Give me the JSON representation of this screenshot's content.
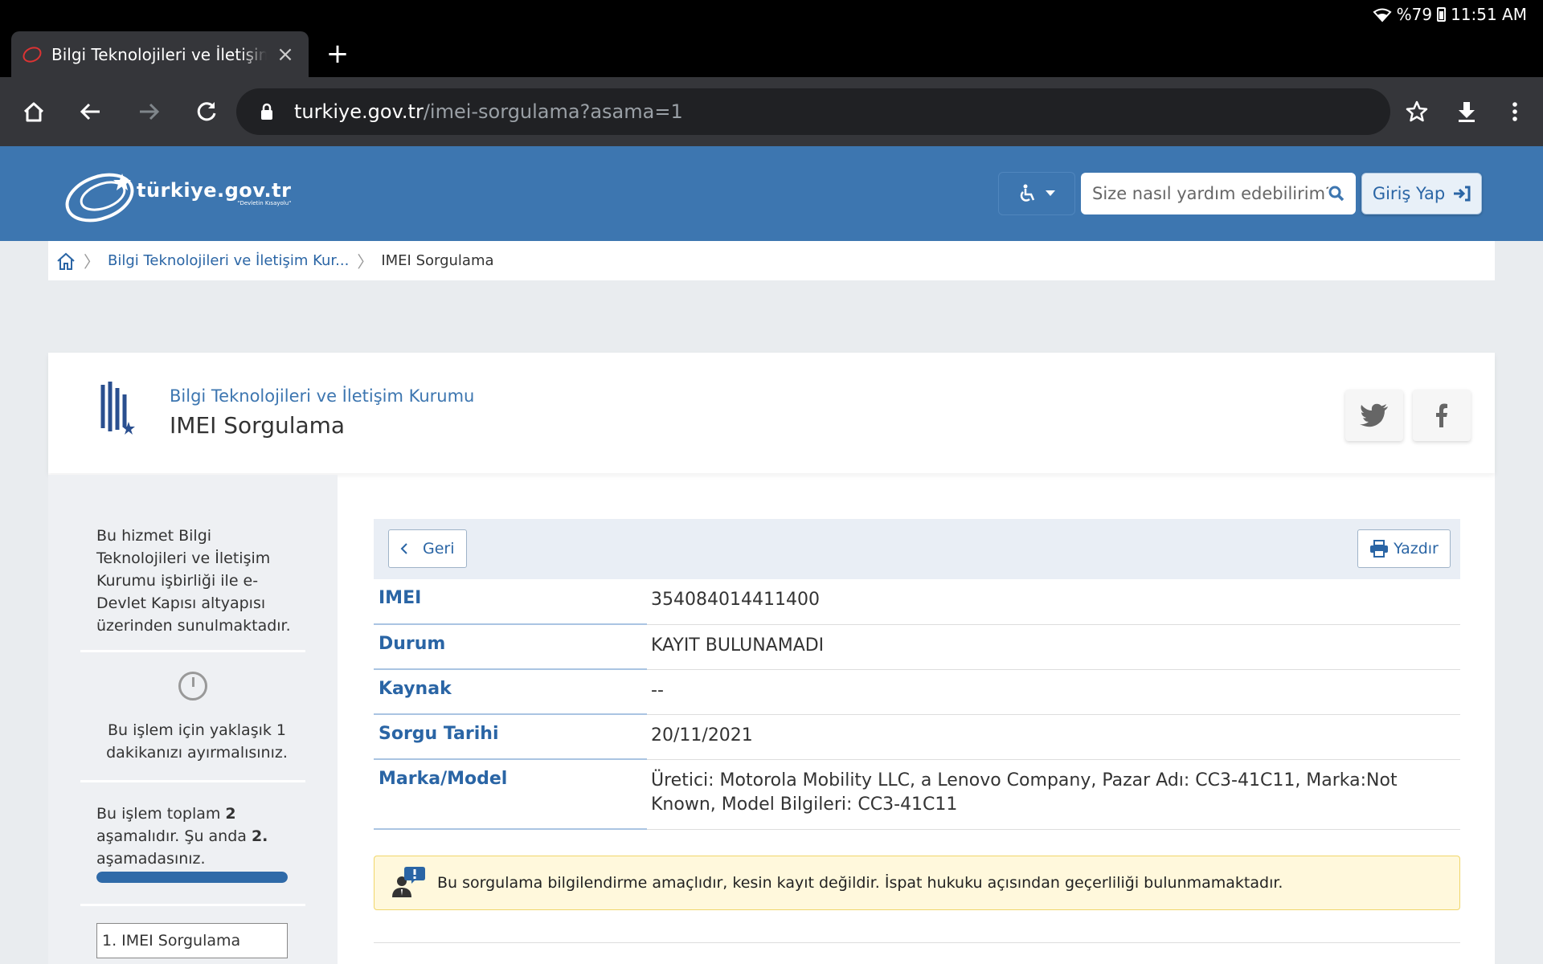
{
  "status_bar": {
    "battery": "%79",
    "time": "11:51 AM"
  },
  "browser": {
    "tab_title": "Bilgi Teknolojileri ve İletişim Kurumu",
    "new_tab_label": "+",
    "close_label": "×",
    "url_domain": "turkiye.gov.tr",
    "url_path": "/imei-sorgulama?asama=1"
  },
  "header": {
    "brand": "türkiye.gov.tr",
    "tagline": "\"Devletin Kısayolu\"",
    "search_placeholder": "Size nasıl yardım edebilirim?",
    "login_label": "Giriş Yap"
  },
  "breadcrumb": {
    "items": [
      "Bilgi Teknolojileri ve İletişim Kur...",
      "IMEI Sorgulama"
    ]
  },
  "service": {
    "institution": "Bilgi Teknolojileri ve İletişim Kurumu",
    "title": "IMEI Sorgulama"
  },
  "sidebar": {
    "info": "Bu hizmet Bilgi Teknolojileri ve İletişim Kurumu işbirliği ile e-Devlet Kapısı altyapısı üzerinden sunulmaktadır.",
    "duration": "Bu işlem için yaklaşık 1 dakikanızı ayırmalısınız.",
    "steps_pre": "Bu işlem toplam ",
    "steps_total": "2",
    "steps_mid": " aşamalıdır. Şu anda ",
    "steps_current": "2.",
    "steps_post": " aşamadasınız.",
    "progress": 1.0,
    "step_label": "1. IMEI Sorgulama"
  },
  "actions": {
    "back_label": "Geri",
    "print_label": "Yazdır"
  },
  "results": [
    {
      "key": "IMEI",
      "value": "354084014411400"
    },
    {
      "key": "Durum",
      "value": "KAYIT BULUNAMADI"
    },
    {
      "key": "Kaynak",
      "value": "--"
    },
    {
      "key": "Sorgu Tarihi",
      "value": "20/11/2021"
    },
    {
      "key": "Marka/Model",
      "value": "Üretici: Motorola Mobility LLC, a Lenovo Company, Pazar Adı: CC3-41C11, Marka:Not Known, Model Bilgileri: CC3-41C11"
    }
  ],
  "notice": "Bu sorgulama bilgilendirme amaçlıdır, kesin kayıt değildir. İspat hukuku açısından geçerliliği bulunmamaktadır.",
  "colors": {
    "header_blue": "#3d76b0",
    "link_blue": "#2a65a5",
    "notice_bg": "#fff8dc"
  }
}
